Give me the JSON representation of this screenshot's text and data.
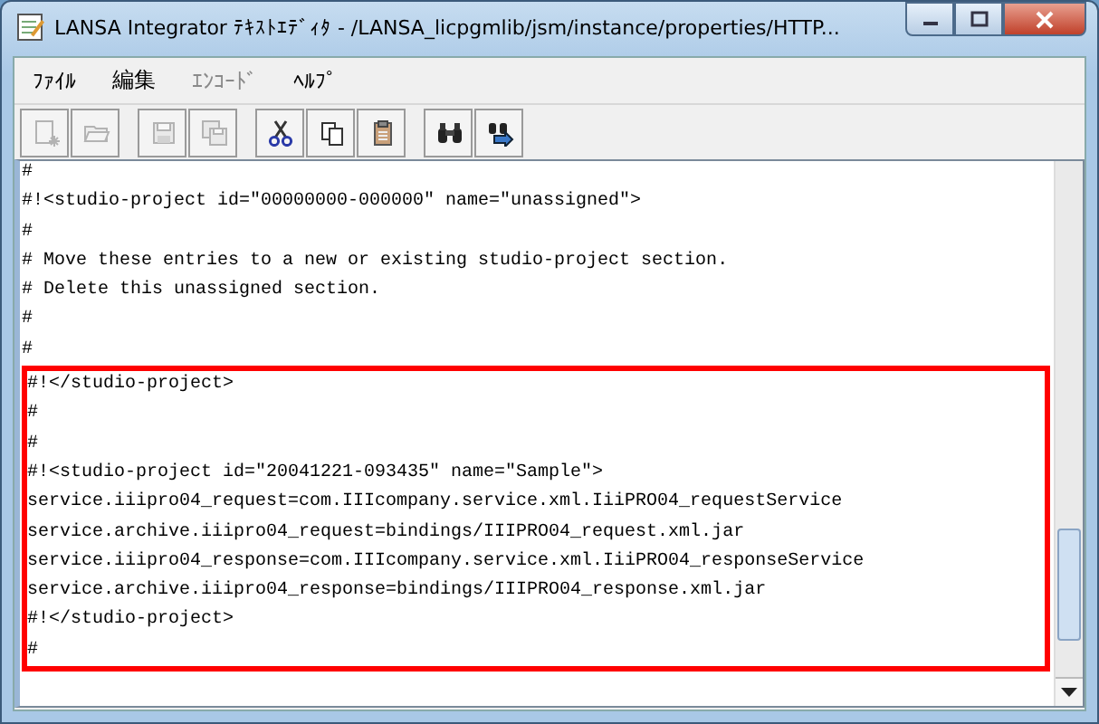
{
  "window": {
    "title": "LANSA Integrator ﾃｷｽﾄｴﾃﾞｨﾀ - /LANSA_licpgmlib/jsm/instance/properties/HTTP..."
  },
  "menu": [
    {
      "label": "ﾌｧｲﾙ",
      "disabled": false
    },
    {
      "label": "編集",
      "disabled": false
    },
    {
      "label": "ｴﾝｺｰﾄﾞ",
      "disabled": true
    },
    {
      "label": "ﾍﾙﾌﾟ",
      "disabled": false
    }
  ],
  "toolbar": [
    [
      {
        "kind": "new",
        "disabled": true
      },
      {
        "kind": "open",
        "disabled": true
      }
    ],
    [
      {
        "kind": "save",
        "disabled": true
      },
      {
        "kind": "save-all",
        "disabled": true
      }
    ],
    [
      {
        "kind": "cut",
        "disabled": false
      },
      {
        "kind": "copy",
        "disabled": false
      },
      {
        "kind": "paste",
        "disabled": false
      }
    ],
    [
      {
        "kind": "find",
        "disabled": false
      },
      {
        "kind": "replace",
        "disabled": false
      }
    ]
  ],
  "editor": {
    "lines": [
      "#",
      "#!<studio-project id=\"00000000-000000\" name=\"unassigned\">",
      "#",
      "# Move these entries to a new or existing studio-project section.",
      "# Delete this unassigned section.",
      "#",
      "#"
    ],
    "highlight_box": {
      "lines": [
        "#!</studio-project>",
        "#",
        "#",
        "#!<studio-project id=\"20041221-093435\" name=\"Sample\">",
        "service.iiipro04_request=com.IIIcompany.service.xml.IiiPRO04_requestService",
        "service.archive.iiipro04_request=bindings/IIIPRO04_request.xml.jar",
        "service.iiipro04_response=com.IIIcompany.service.xml.IiiPRO04_responseService",
        "service.archive.iiipro04_response=bindings/IIIPRO04_response.xml.jar",
        "#!</studio-project>",
        "#"
      ]
    }
  }
}
